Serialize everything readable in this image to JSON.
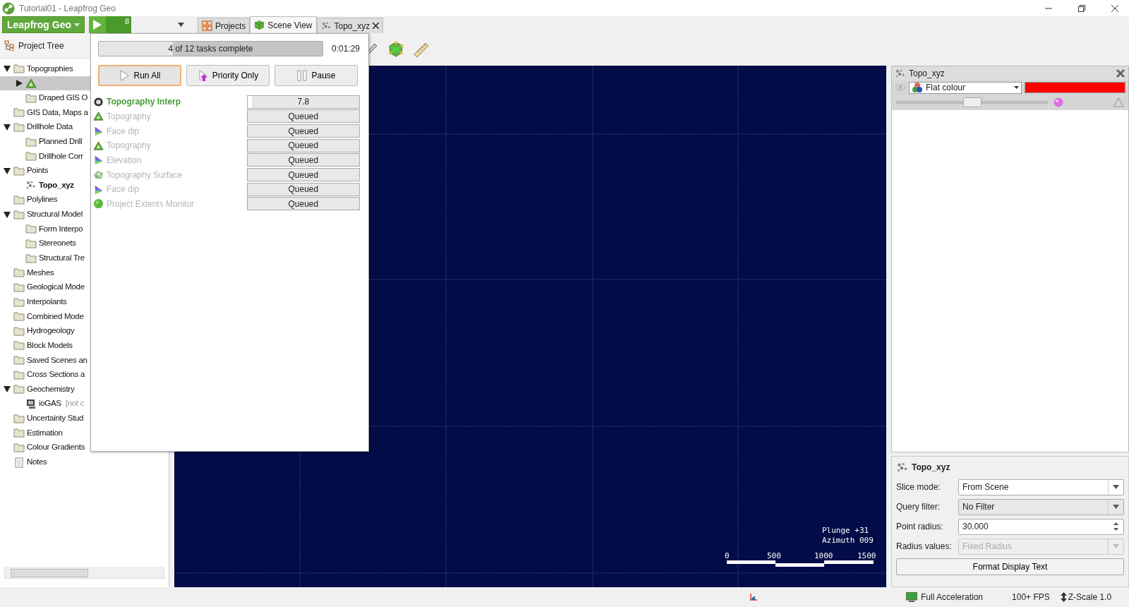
{
  "window": {
    "title": "Tutorial01 - Leapfrog Geo"
  },
  "app_menu": {
    "label": "Leapfrog Geo"
  },
  "run_button": {
    "count": "8"
  },
  "tabs": [
    {
      "label": "Projects",
      "kind": "grid",
      "selected": false,
      "closable": false
    },
    {
      "label": "Scene View",
      "kind": "cube",
      "selected": true,
      "closable": false
    },
    {
      "label": "Topo_xyz",
      "kind": "points",
      "selected": false,
      "closable": true
    }
  ],
  "project_tree": {
    "title": "Project Tree",
    "items": [
      {
        "label": "Topographies",
        "kind": "folder",
        "selected": false,
        "expanded": true,
        "children": [
          {
            "kind": "mountain",
            "selected": true,
            "expanded": false
          },
          {
            "label": "Draped GIS O",
            "kind": "folder",
            "selected": false
          }
        ]
      },
      {
        "label": "GIS Data, Maps a",
        "kind": "folder",
        "selected": false
      },
      {
        "label": "Drillhole Data",
        "kind": "folder",
        "selected": false,
        "expanded": true,
        "children": [
          {
            "label": "Planned Drill",
            "kind": "folder",
            "selected": false
          },
          {
            "label": "Drillhole Corr",
            "kind": "folder",
            "selected": false
          }
        ]
      },
      {
        "label": "Points",
        "kind": "folder",
        "selected": false,
        "expanded": true,
        "children": [
          {
            "label": "Topo_xyz",
            "kind": "points",
            "selected": false,
            "bold": true
          }
        ]
      },
      {
        "label": "Polylines",
        "kind": "folder",
        "selected": false
      },
      {
        "label": "Structural Model",
        "kind": "folder",
        "selected": false,
        "expanded": true,
        "children": [
          {
            "label": "Form Interpo",
            "kind": "folder",
            "selected": false
          },
          {
            "label": "Stereonets",
            "kind": "folder",
            "selected": false
          },
          {
            "label": "Structural Tre",
            "kind": "folder",
            "selected": false
          }
        ]
      },
      {
        "label": "Meshes",
        "kind": "folder",
        "selected": false
      },
      {
        "label": "Geological Mode",
        "kind": "folder",
        "selected": false
      },
      {
        "label": "Interpolants",
        "kind": "folder",
        "selected": false
      },
      {
        "label": "Combined Mode",
        "kind": "folder",
        "selected": false
      },
      {
        "label": "Hydrogeology",
        "kind": "folder",
        "selected": false
      },
      {
        "label": "Block Models",
        "kind": "folder",
        "selected": false
      },
      {
        "label": "Saved Scenes an",
        "kind": "folder",
        "selected": false
      },
      {
        "label": "Cross Sections a",
        "kind": "folder",
        "selected": false
      },
      {
        "label": "Geochemistry",
        "kind": "folder",
        "selected": false,
        "expanded": true,
        "children": [
          {
            "label": "ioGAS",
            "suffix": "[not c",
            "kind": "monitor",
            "selected": false
          }
        ]
      },
      {
        "label": "Uncertainty Stud",
        "kind": "folder",
        "selected": false
      },
      {
        "label": "Estimation",
        "kind": "folder",
        "selected": false
      },
      {
        "label": "Colour Gradients",
        "kind": "folder",
        "selected": false
      },
      {
        "label": "Notes",
        "kind": "notes",
        "selected": false
      }
    ]
  },
  "task_popup": {
    "progress": {
      "text": "4 of 12 tasks complete",
      "level": 0.33
    },
    "elapsed": "0:01:29",
    "buttons": [
      {
        "label": "Run All",
        "kind": "play",
        "default": true
      },
      {
        "label": "Priority Only",
        "kind": "priority",
        "default": false
      },
      {
        "label": "Pause",
        "kind": "pause",
        "default": false
      }
    ],
    "tasks": [
      {
        "name": "Topography Interp",
        "kind": "ring",
        "active": true,
        "status": "7.8",
        "level": 0.05
      },
      {
        "name": "Topography",
        "kind": "mountain",
        "active": false,
        "status": "Queued"
      },
      {
        "name": "Face dip",
        "kind": "dip",
        "active": false,
        "status": "Queued"
      },
      {
        "name": "Topography",
        "kind": "mountain",
        "active": false,
        "status": "Queued"
      },
      {
        "name": "Elevation",
        "kind": "dip",
        "active": false,
        "status": "Queued"
      },
      {
        "name": "Topography Surface",
        "kind": "surface",
        "active": false,
        "status": "Queued"
      },
      {
        "name": "Face dip",
        "kind": "dip",
        "active": false,
        "status": "Queued"
      },
      {
        "name": "Project Extents Monitor",
        "kind": "sphere",
        "active": false,
        "status": "Queued"
      }
    ]
  },
  "scene": {
    "plunge": "Plunge +31",
    "azimuth": "Azimuth 009",
    "scale_labels": [
      "0",
      "500",
      "1000",
      "1500"
    ]
  },
  "layer": {
    "name": "Topo_xyz",
    "style": "Flat colour",
    "color": "#ff0000",
    "level": 0.5
  },
  "properties": {
    "title": "Topo_xyz",
    "fields": [
      {
        "label": "Slice mode:",
        "value": "From Scene",
        "kind": "select",
        "disabled": false
      },
      {
        "label": "Query filter:",
        "value": "No Filter",
        "kind": "select",
        "disabled": false
      },
      {
        "label": "Point radius:",
        "value": "30.000",
        "kind": "spin",
        "disabled": false
      },
      {
        "label": "Radius values:",
        "value": "Fixed Radius",
        "kind": "select",
        "disabled": true
      }
    ],
    "button": "Format Display Text"
  },
  "status_bar": {
    "acceleration": "Full Acceleration",
    "fps": "100+ FPS",
    "z_scale": "Z-Scale 1.0"
  }
}
